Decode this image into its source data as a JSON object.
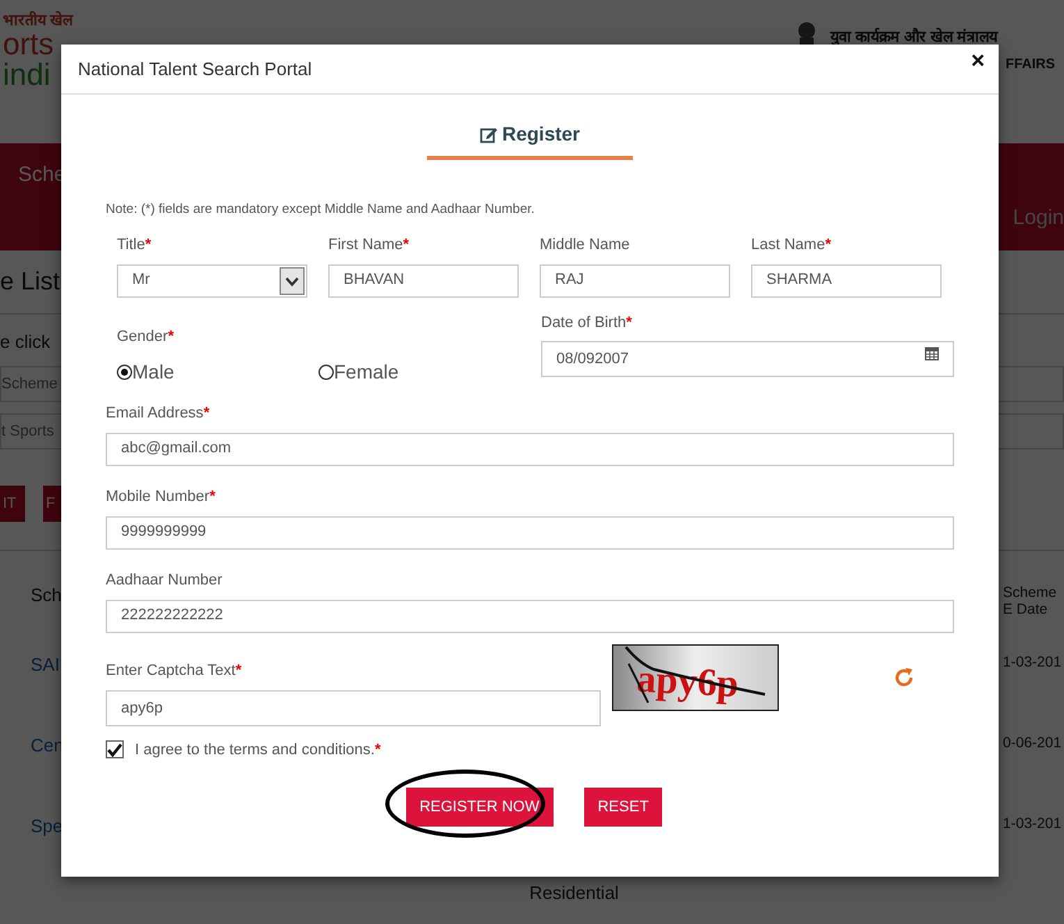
{
  "background_page": {
    "logo": [
      "भारतीय खेल",
      "orts",
      "indi"
    ],
    "ministry_hindi": "युवा कार्यक्रम और खेल मंत्रालय",
    "ministry_english": "FFAIRS",
    "nav_item": "Sche",
    "login": "Login",
    "heading": "e List",
    "hint": "e click",
    "filters": [
      "Scheme",
      "t Sports"
    ],
    "buttons": [
      "IT",
      "F"
    ],
    "table": {
      "column_1": "Sch",
      "column_2": "Scheme E Date",
      "rows": [
        {
          "name": "SAI",
          "date": "1-03-201"
        },
        {
          "name": "Cen",
          "date": "0-06-201"
        },
        {
          "name": "Spe",
          "date": "1-03-201",
          "detail": "Residential"
        }
      ]
    }
  },
  "window": {
    "title": "National Talent Search Portal",
    "close": "×"
  },
  "tab": {
    "label": "Register",
    "selected": true
  },
  "note": "Note: (*) fields are mandatory except Middle Name and Aadhaar Number.",
  "name_fields": [
    {
      "kind": "select",
      "label": "Title",
      "mark": "*",
      "value": "Mr"
    },
    {
      "kind": "text",
      "label": "First Name",
      "mark": "*",
      "value": "BHAVAN"
    },
    {
      "kind": "text",
      "label": "Middle Name",
      "value": "RAJ"
    },
    {
      "kind": "text",
      "label": "Last Name",
      "mark": "*",
      "value": "SHARMA"
    }
  ],
  "gender": {
    "label": "Gender",
    "mark": "*",
    "options": [
      {
        "label": "Male",
        "selected": true
      },
      {
        "label": "Female",
        "selected": false
      }
    ]
  },
  "date_of_birth": {
    "label": "Date of Birth",
    "mark": "*",
    "value": "08/092007"
  },
  "contact_fields": [
    {
      "label": "Email Address",
      "mark": "*",
      "value": "abc@gmail.com"
    },
    {
      "label": "Mobile Number",
      "mark": "*",
      "value": "9999999999"
    },
    {
      "label": "Aadhaar Number",
      "value": "222222222222"
    }
  ],
  "captcha": {
    "label": "Enter Captcha Text",
    "mark": "*",
    "value": "apy6p",
    "image_text": "apy6p"
  },
  "agree": {
    "label": "I agree to the terms and conditions.",
    "mark": "*",
    "checked": true
  },
  "buttons": [
    {
      "label": "REGISTER NOW",
      "highlighted": true
    },
    {
      "label": "RESET",
      "highlighted": false
    }
  ]
}
